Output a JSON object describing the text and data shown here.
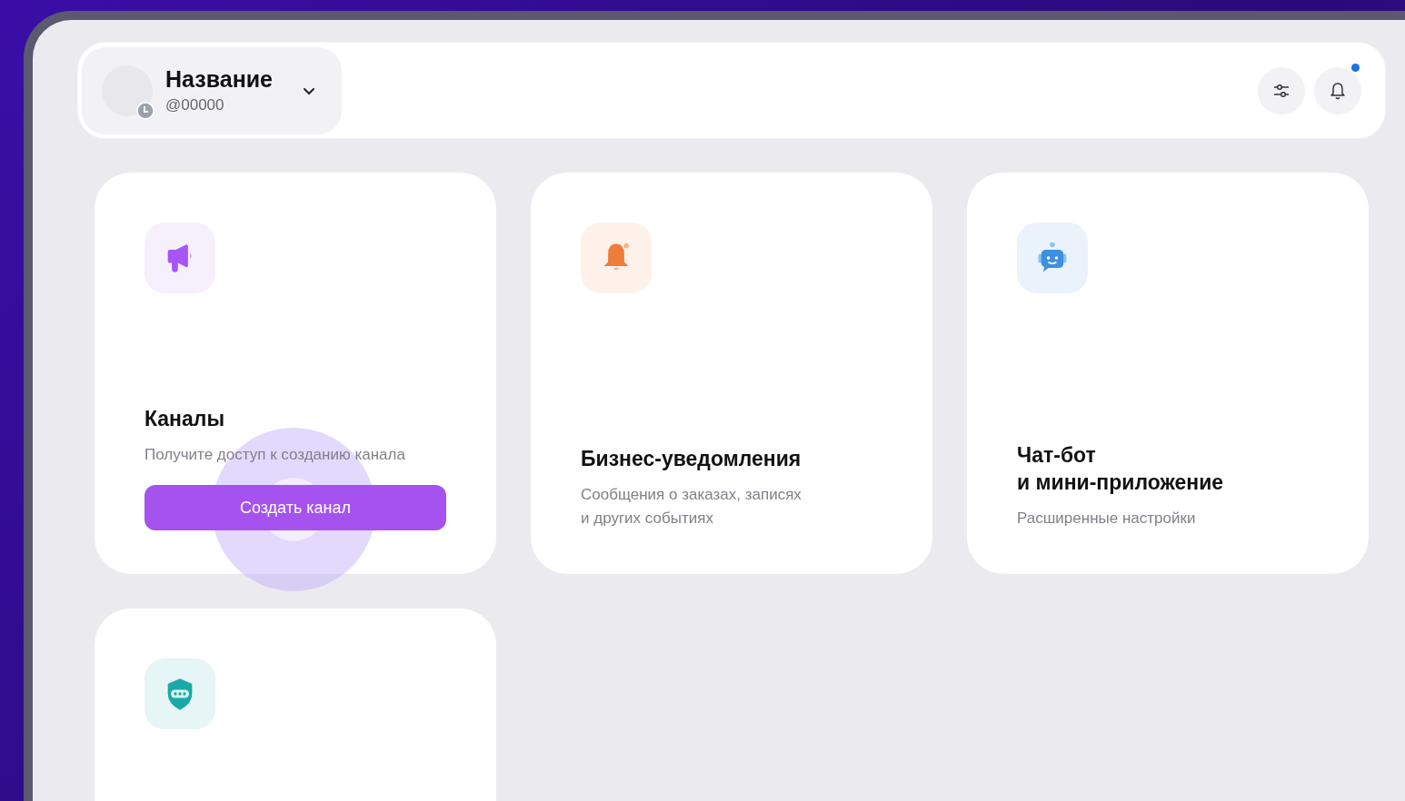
{
  "header": {
    "account": {
      "name": "Название",
      "handle": "@00000"
    },
    "notifications": {
      "unread": true
    }
  },
  "cards": [
    {
      "kind": "channels",
      "title": "Каналы",
      "description": "Получите доступ к созданию канала",
      "button": "Создать канал",
      "pressed": true
    },
    {
      "kind": "notifications",
      "title": "Бизнес-уведомления",
      "description": "Сообщения о заказах, записях\nи других событиях"
    },
    {
      "kind": "bot",
      "title": "Чат-бот\nи мини-приложение",
      "description": "Расширенные настройки"
    },
    {
      "kind": "security"
    }
  ]
}
